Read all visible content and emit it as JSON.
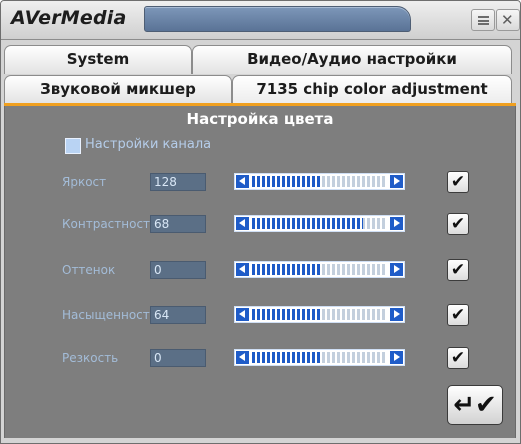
{
  "window": {
    "brand": "AVerMedia",
    "menu_icon": "menu-icon",
    "close_icon": "close-icon",
    "close_glyph": "✕"
  },
  "tabs": [
    {
      "label": "System"
    },
    {
      "label": "Видео/Аудио настройки"
    },
    {
      "label": "Звуковой микшер"
    },
    {
      "label": "7135 chip color adjustment",
      "active": true
    }
  ],
  "panel": {
    "title": "Настройка цвета",
    "channel_settings_label": "Настройки канала",
    "channel_settings_checked": false,
    "rows": [
      {
        "label": "Яркост",
        "value": "128",
        "level": 0.5,
        "enabled": true
      },
      {
        "label": "Контрастность",
        "value": "68",
        "level": 0.82,
        "enabled": true
      },
      {
        "label": "Оттенок",
        "value": "0",
        "level": 0.5,
        "enabled": true
      },
      {
        "label": "Насыщенность",
        "value": "64",
        "level": 0.5,
        "enabled": true
      },
      {
        "label": "Резкость",
        "value": "0",
        "level": 0.5,
        "enabled": true
      }
    ],
    "check_glyph": "✔",
    "apply_glyph": "↵✔"
  },
  "colors": {
    "accent": "#f0a020",
    "slider_fill": "#1d5ac7",
    "panel_bg": "#7e7e7e",
    "label_text": "#a3bcd8"
  }
}
